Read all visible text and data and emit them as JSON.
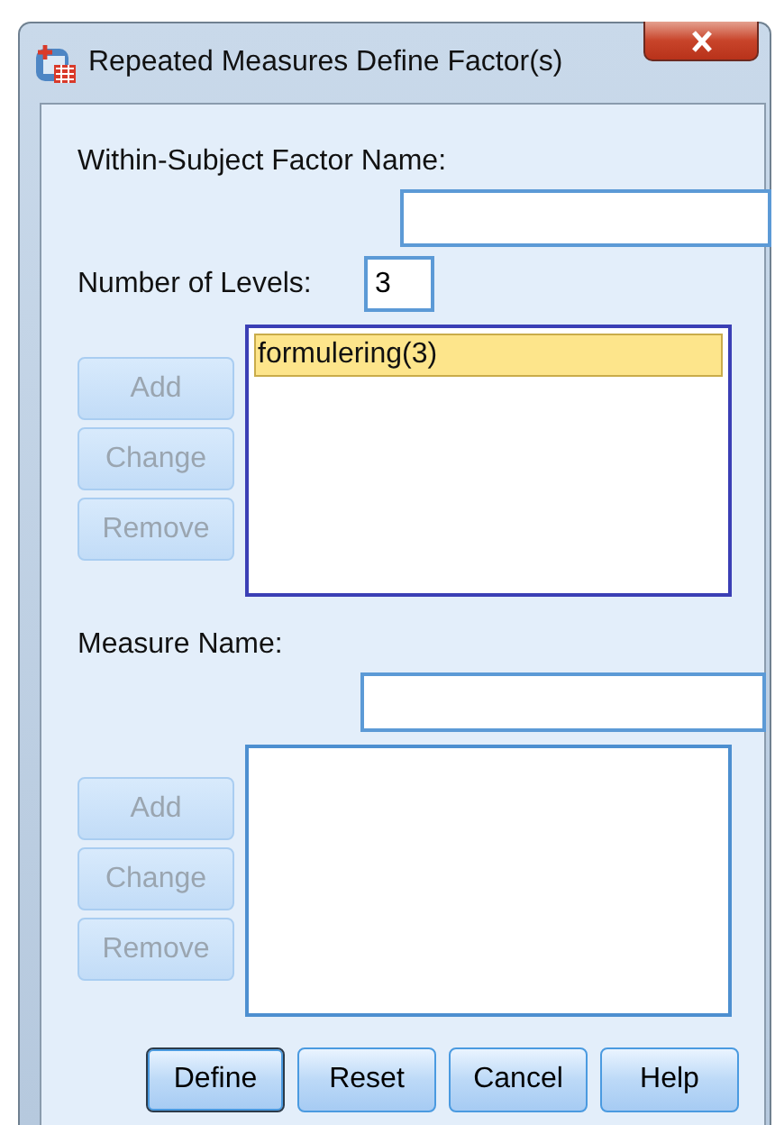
{
  "window": {
    "title": "Repeated Measures Define Factor(s)"
  },
  "factor": {
    "name_label": "Within-Subject Factor Name:",
    "levels_label": "Number of Levels:",
    "levels_value": "3",
    "list": [
      {
        "text": "formulering(3)",
        "selected": true
      }
    ],
    "buttons": [
      {
        "label": "Add",
        "disabled": true
      },
      {
        "label": "Change",
        "disabled": true
      },
      {
        "label": "Remove",
        "disabled": true
      }
    ]
  },
  "measure": {
    "name_label": "Measure Name:",
    "buttons": [
      {
        "label": "Add",
        "disabled": true
      },
      {
        "label": "Change",
        "disabled": true
      },
      {
        "label": "Remove",
        "disabled": true
      }
    ]
  },
  "actions": [
    {
      "label": "Define",
      "default": true
    },
    {
      "label": "Reset",
      "default": false
    },
    {
      "label": "Cancel",
      "default": false
    },
    {
      "label": "Help",
      "default": false
    }
  ]
}
